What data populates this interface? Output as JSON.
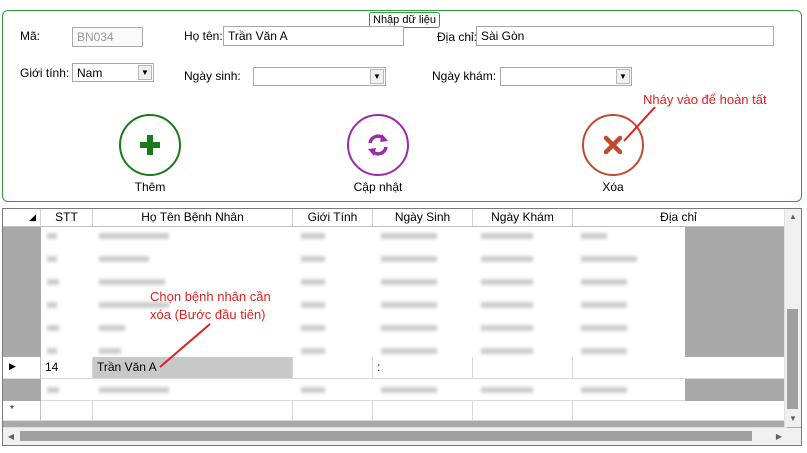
{
  "form": {
    "title": "Nhập dữ liệu",
    "ma_label": "Mã:",
    "ma_value": "BN034",
    "hoten_label": "Họ tên:",
    "hoten_value": "Trần Văn A",
    "diachi_label": "Địa chỉ:",
    "diachi_value": "Sài Gòn",
    "gioitinh_label": "Giới tính:",
    "gioitinh_value": "Nam",
    "ngaysinh_label": "Ngày sinh:",
    "ngaysinh_value": "",
    "ngaykham_label": "Ngày khám:",
    "ngaykham_value": ""
  },
  "buttons": {
    "them": "Thêm",
    "capnhat": "Cập nhật",
    "xoa": "Xóa"
  },
  "annotations": {
    "top": "Nháy vào để hoàn tất",
    "grid_line1": "Chọn bệnh nhân cần",
    "grid_line2": "xóa (Bước đầu tiên)"
  },
  "grid": {
    "columns": [
      "STT",
      "Họ Tên Bệnh Nhân",
      "Giới Tính",
      "Ngày Sinh",
      "Ngày Khám",
      "Địa chỉ"
    ],
    "selected_row": {
      "stt": "14",
      "name": "Trần Văn A",
      "gender": "",
      "dob": ":",
      "visit": "",
      "address": ""
    }
  },
  "colors": {
    "group_border": "#2e9e3c",
    "them": "#1a7a1a",
    "capnhat": "#9b2bab",
    "xoa": "#c04a30",
    "annotation": "#e01f1f"
  }
}
